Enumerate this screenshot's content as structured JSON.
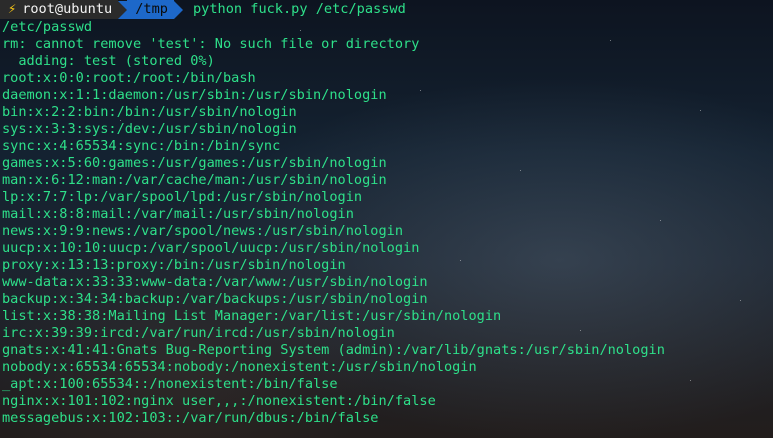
{
  "prompt": {
    "bolt": "⚡",
    "user_host": "root@ubuntu",
    "cwd": "/tmp",
    "command": "python fuck.py /etc/passwd"
  },
  "output_lines": [
    "/etc/passwd",
    "rm: cannot remove 'test': No such file or directory",
    "  adding: test (stored 0%)",
    "root:x:0:0:root:/root:/bin/bash",
    "daemon:x:1:1:daemon:/usr/sbin:/usr/sbin/nologin",
    "bin:x:2:2:bin:/bin:/usr/sbin/nologin",
    "sys:x:3:3:sys:/dev:/usr/sbin/nologin",
    "sync:x:4:65534:sync:/bin:/bin/sync",
    "games:x:5:60:games:/usr/games:/usr/sbin/nologin",
    "man:x:6:12:man:/var/cache/man:/usr/sbin/nologin",
    "lp:x:7:7:lp:/var/spool/lpd:/usr/sbin/nologin",
    "mail:x:8:8:mail:/var/mail:/usr/sbin/nologin",
    "news:x:9:9:news:/var/spool/news:/usr/sbin/nologin",
    "uucp:x:10:10:uucp:/var/spool/uucp:/usr/sbin/nologin",
    "proxy:x:13:13:proxy:/bin:/usr/sbin/nologin",
    "www-data:x:33:33:www-data:/var/www:/usr/sbin/nologin",
    "backup:x:34:34:backup:/var/backups:/usr/sbin/nologin",
    "list:x:38:38:Mailing List Manager:/var/list:/usr/sbin/nologin",
    "irc:x:39:39:ircd:/var/run/ircd:/usr/sbin/nologin",
    "gnats:x:41:41:Gnats Bug-Reporting System (admin):/var/lib/gnats:/usr/sbin/nologin",
    "nobody:x:65534:65534:nobody:/nonexistent:/usr/sbin/nologin",
    "_apt:x:100:65534::/nonexistent:/bin/false",
    "nginx:x:101:102:nginx user,,,:/nonexistent:/bin/false",
    "messagebus:x:102:103::/var/run/dbus:/bin/false"
  ],
  "colors": {
    "text": "#2ee08a",
    "host_segment": "#2b2b2b",
    "dir_segment": "#1d68c9",
    "bolt": "#f5c518"
  }
}
